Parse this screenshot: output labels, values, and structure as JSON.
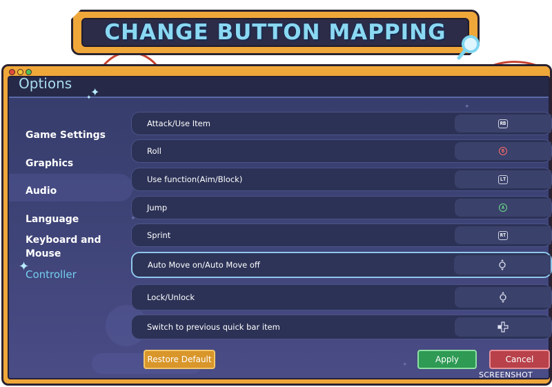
{
  "banner": {
    "title": "CHANGE BUTTON MAPPING",
    "icon": "magnifier-icon"
  },
  "window": {
    "title": "Options"
  },
  "sidebar": {
    "items": [
      {
        "label": "Game Settings"
      },
      {
        "label": "Graphics"
      },
      {
        "label": "Audio"
      },
      {
        "label": "Language"
      },
      {
        "label": "Keyboard and Mouse"
      },
      {
        "label": "Controller",
        "active": true
      }
    ]
  },
  "mappings": [
    {
      "action": "Attack/Use Item",
      "button": "RB"
    },
    {
      "action": "Roll",
      "button": "B"
    },
    {
      "action": "Use function(Aim/Block)",
      "button": "LT"
    },
    {
      "action": "Jump",
      "button": "A"
    },
    {
      "action": "Sprint",
      "button": "RT"
    },
    {
      "action": "Auto Move on/Auto Move off",
      "button": "left-stick-press-icon"
    },
    {
      "action": "Lock/Unlock",
      "button": "right-stick-press-icon"
    },
    {
      "action": "Switch to previous quick bar item",
      "button": "dpad-left-icon"
    }
  ],
  "buttons": {
    "restore": "Restore Default",
    "apply": "Apply",
    "cancel": "Cancel"
  },
  "watermark": "SCREENSHOT",
  "colors": {
    "frame": "#f0a73a",
    "accent": "#74cff0",
    "apply": "#2e9a54",
    "cancel": "#b8414a",
    "restore": "#d9962a"
  }
}
